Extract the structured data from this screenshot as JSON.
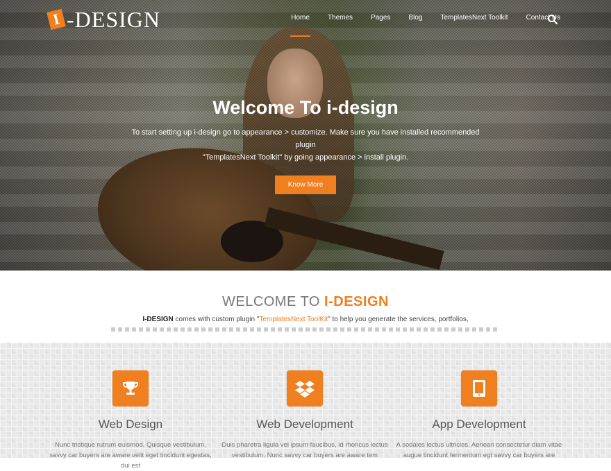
{
  "header": {
    "logo_mark": "I",
    "logo_text": "-DESIGN",
    "menu": [
      "Home",
      "Themes",
      "Pages",
      "Blog",
      "TemplatesNext Toolkit",
      "Contact Us"
    ],
    "active_menu": "Home"
  },
  "hero": {
    "title": "Welcome To i-design",
    "text_line1": "To start setting up i-design go to appearance > customize. Make sure you have installed recommended plugin",
    "text_line2": "\"TemplatesNext Toolkit\" by going appearance > install plugin.",
    "button": "Know More"
  },
  "welcome": {
    "title_prefix": "WELCOME TO ",
    "title_accent": "I-DESIGN",
    "brand": "I-DESIGN",
    "text_a": " comes with custom plugin \"",
    "link": "TemplatesNext ToolKit",
    "text_b": "\" to help you generate the services, portfolios,"
  },
  "services": [
    {
      "icon": "trophy-icon",
      "title": "Web Design",
      "text": "Nunc tristique rutrum euismod. Quisque vestibulum, savvy car buyers are aware velit eget tincidunt egestas, dui est"
    },
    {
      "icon": "dropbox-icon",
      "title": "Web Development",
      "text": "Duis pharetra ligula vel ipsum faucibus, id rhoncus lectus vestibulum. Nunc savvy car buyers are aware tem"
    },
    {
      "icon": "tablet-icon",
      "title": "App Development",
      "text": "A sodales lectus ultricies. Aenean consectetur diam vitae augue tincidunt fermentum egt savvy car buyers are"
    }
  ],
  "colors": {
    "accent": "#ef7f1f"
  }
}
